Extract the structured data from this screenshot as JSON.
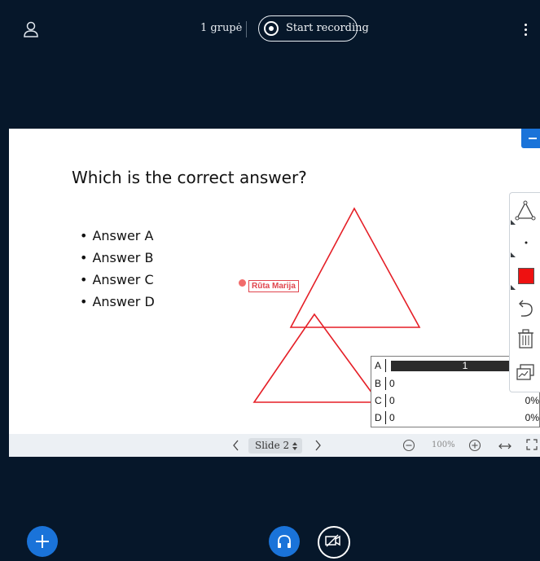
{
  "topbar": {
    "group_label": "1 grupė",
    "record_label": "Start recording"
  },
  "slide": {
    "question": "Which is the correct answer?",
    "answers": [
      "Answer A",
      "Answer B",
      "Answer C",
      "Answer D"
    ],
    "cursor_name": "Rūta Marija"
  },
  "poll": {
    "rows": [
      {
        "option": "A",
        "count": "1",
        "percent": "",
        "bar_fraction": 1.0
      },
      {
        "option": "B",
        "count": "0",
        "percent": ""
      },
      {
        "option": "C",
        "count": "0",
        "percent": "0%"
      },
      {
        "option": "D",
        "count": "0",
        "percent": "0%"
      }
    ]
  },
  "tools": {
    "items": [
      "triangle-tool",
      "thickness-tool",
      "color-tool",
      "undo-tool",
      "clear-tool",
      "multi-user-tool"
    ],
    "active_color": "#ee1111"
  },
  "controls": {
    "slide_label": "Slide 2",
    "zoom": "100%"
  },
  "colors": {
    "background": "#06172a",
    "accent": "#1a73d9",
    "annotation": "#e51f27"
  }
}
